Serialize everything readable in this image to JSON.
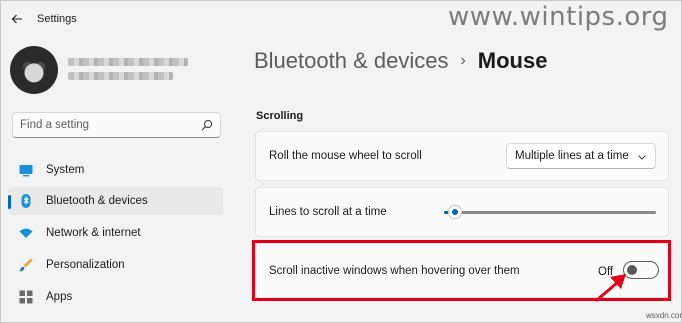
{
  "window": {
    "title": "Settings"
  },
  "watermark": "www.wintips.org",
  "search": {
    "placeholder": "Find a setting"
  },
  "sidebar": {
    "items": [
      {
        "label": "System",
        "icon": "system-icon",
        "active": false
      },
      {
        "label": "Bluetooth & devices",
        "icon": "bluetooth-icon",
        "active": true
      },
      {
        "label": "Network & internet",
        "icon": "wifi-icon",
        "active": false
      },
      {
        "label": "Personalization",
        "icon": "paintbrush-icon",
        "active": false
      },
      {
        "label": "Apps",
        "icon": "apps-icon",
        "active": false
      }
    ]
  },
  "breadcrumb": {
    "parent": "Bluetooth & devices",
    "separator": "›",
    "current": "Mouse"
  },
  "scrolling": {
    "title": "Scrolling",
    "wheel": {
      "label": "Roll the mouse wheel to scroll",
      "value": "Multiple lines at a time"
    },
    "lines": {
      "label": "Lines to scroll at a time",
      "level_fraction": 0.05
    },
    "inactive": {
      "label": "Scroll inactive windows when hovering over them",
      "state": "Off"
    }
  },
  "footer": "wsxdn.com",
  "colors": {
    "accent": "#0067c0",
    "highlight": "#e0001a"
  }
}
